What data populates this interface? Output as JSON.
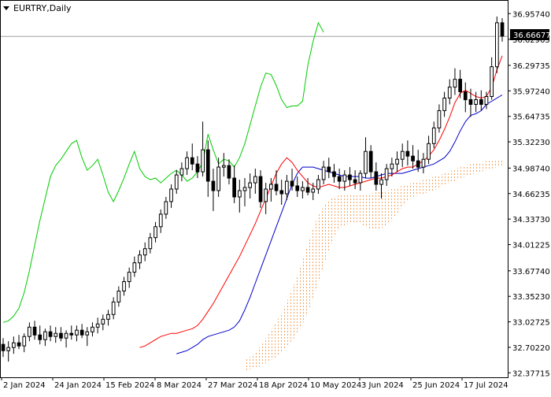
{
  "header": {
    "symbol_timeframe": "EURTRY,Daily"
  },
  "colors": {
    "background": "#ffffff",
    "frame": "#000000",
    "candle": "#000000",
    "tenkan": "#ff0000",
    "kijun": "#0000cc",
    "chikou": "#00cc00",
    "kumo": "#f4a460",
    "price_line": "#a0a0a0",
    "price_label_bg": "#000000",
    "price_label_text": "#ffffff"
  },
  "icons": {
    "menu": "triangle-down-icon"
  },
  "chart_data": {
    "type": "candlestick",
    "title": "EURTRY,Daily",
    "indicator": "Ichimoku Kinko Hyo",
    "current_price": "36.66677",
    "y_axis_labels": [
      "36.95740",
      "36.62965",
      "36.29735",
      "35.97240",
      "35.64735",
      "35.32230",
      "34.98740",
      "34.66235",
      "34.33730",
      "34.01225",
      "33.67740",
      "33.35230",
      "33.02725",
      "32.70220",
      "32.37715"
    ],
    "ylim": [
      32.35,
      36.98
    ],
    "x_axis_labels": [
      "2 Jan 2024",
      "24 Jan 2024",
      "15 Feb 2024",
      "8 Mar 2024",
      "27 Mar 2024",
      "18 Apr 2024",
      "10 May 2024",
      "3 Jun 2024",
      "25 Jun 2024",
      "17 Jul 2024"
    ],
    "grid": false,
    "ohlc": [
      [
        32.74,
        32.82,
        32.58,
        32.66
      ],
      [
        32.66,
        32.78,
        32.52,
        32.7
      ],
      [
        32.7,
        32.84,
        32.62,
        32.76
      ],
      [
        32.76,
        32.86,
        32.68,
        32.72
      ],
      [
        32.72,
        32.88,
        32.64,
        32.84
      ],
      [
        32.84,
        33.02,
        32.78,
        32.96
      ],
      [
        32.96,
        33.04,
        32.8,
        32.86
      ],
      [
        32.86,
        32.98,
        32.74,
        32.8
      ],
      [
        32.8,
        32.94,
        32.72,
        32.9
      ],
      [
        32.9,
        32.98,
        32.78,
        32.84
      ],
      [
        32.84,
        32.96,
        32.76,
        32.88
      ],
      [
        32.88,
        32.96,
        32.78,
        32.82
      ],
      [
        32.82,
        32.92,
        32.7,
        32.88
      ],
      [
        32.88,
        32.98,
        32.8,
        32.86
      ],
      [
        32.86,
        32.98,
        32.78,
        32.92
      ],
      [
        32.92,
        33.0,
        32.82,
        32.86
      ],
      [
        32.86,
        32.96,
        32.72,
        32.9
      ],
      [
        32.9,
        33.02,
        32.84,
        32.96
      ],
      [
        32.96,
        33.08,
        32.88,
        33.0
      ],
      [
        33.0,
        33.12,
        32.92,
        33.06
      ],
      [
        33.06,
        33.18,
        32.98,
        33.12
      ],
      [
        33.12,
        33.34,
        33.06,
        33.28
      ],
      [
        33.28,
        33.48,
        33.22,
        33.42
      ],
      [
        33.42,
        33.6,
        33.36,
        33.54
      ],
      [
        33.54,
        33.72,
        33.46,
        33.66
      ],
      [
        33.66,
        33.86,
        33.6,
        33.78
      ],
      [
        33.78,
        33.94,
        33.7,
        33.88
      ],
      [
        33.88,
        34.04,
        33.8,
        33.96
      ],
      [
        33.96,
        34.16,
        33.9,
        34.1
      ],
      [
        34.1,
        34.3,
        34.04,
        34.24
      ],
      [
        34.24,
        34.46,
        34.16,
        34.4
      ],
      [
        34.4,
        34.62,
        34.34,
        34.56
      ],
      [
        34.56,
        34.78,
        34.48,
        34.72
      ],
      [
        34.72,
        34.96,
        34.66,
        34.9
      ],
      [
        34.9,
        35.06,
        34.82,
        34.98
      ],
      [
        34.98,
        35.2,
        34.9,
        35.12
      ],
      [
        35.12,
        35.3,
        34.96,
        35.04
      ],
      [
        35.04,
        35.14,
        34.86,
        34.94
      ],
      [
        34.94,
        35.58,
        34.88,
        35.22
      ],
      [
        35.22,
        35.34,
        34.62,
        34.82
      ],
      [
        34.82,
        34.98,
        34.44,
        34.7
      ],
      [
        34.7,
        35.12,
        34.62,
        35.0
      ],
      [
        35.0,
        35.18,
        34.88,
        35.02
      ],
      [
        35.02,
        35.1,
        34.78,
        34.86
      ],
      [
        34.86,
        35.02,
        34.54,
        34.62
      ],
      [
        34.62,
        34.84,
        34.42,
        34.7
      ],
      [
        34.7,
        34.86,
        34.5,
        34.74
      ],
      [
        34.74,
        34.92,
        34.6,
        34.8
      ],
      [
        34.8,
        34.98,
        34.66,
        34.88
      ],
      [
        34.88,
        34.96,
        34.48,
        34.56
      ],
      [
        34.56,
        34.8,
        34.4,
        34.72
      ],
      [
        34.72,
        34.86,
        34.56,
        34.78
      ],
      [
        34.78,
        34.96,
        34.64,
        34.7
      ],
      [
        34.7,
        34.84,
        34.52,
        34.66
      ],
      [
        34.66,
        34.9,
        34.58,
        34.82
      ],
      [
        34.82,
        34.98,
        34.7,
        34.76
      ],
      [
        34.76,
        34.88,
        34.62,
        34.7
      ],
      [
        34.7,
        34.82,
        34.6,
        34.74
      ],
      [
        34.74,
        34.86,
        34.64,
        34.68
      ],
      [
        34.68,
        34.8,
        34.58,
        34.72
      ],
      [
        34.72,
        34.9,
        34.66,
        34.84
      ],
      [
        34.84,
        35.08,
        34.78,
        35.0
      ],
      [
        35.0,
        35.12,
        34.86,
        34.94
      ],
      [
        34.94,
        35.04,
        34.8,
        34.88
      ],
      [
        34.88,
        34.98,
        34.72,
        34.82
      ],
      [
        34.82,
        34.96,
        34.7,
        34.9
      ],
      [
        34.9,
        35.0,
        34.76,
        34.84
      ],
      [
        34.84,
        34.96,
        34.72,
        34.8
      ],
      [
        34.8,
        34.96,
        34.7,
        34.92
      ],
      [
        34.92,
        35.38,
        34.86,
        35.2
      ],
      [
        35.2,
        35.28,
        34.86,
        34.94
      ],
      [
        34.94,
        35.06,
        34.7,
        34.78
      ],
      [
        34.78,
        34.92,
        34.6,
        34.84
      ],
      [
        34.84,
        35.04,
        34.76,
        34.98
      ],
      [
        34.98,
        35.12,
        34.88,
        35.04
      ],
      [
        35.04,
        35.2,
        34.94,
        35.1
      ],
      [
        35.1,
        35.3,
        35.0,
        35.2
      ],
      [
        35.2,
        35.34,
        35.02,
        35.14
      ],
      [
        35.14,
        35.28,
        34.98,
        35.08
      ],
      [
        35.08,
        35.22,
        34.94,
        35.0
      ],
      [
        35.0,
        35.18,
        34.92,
        35.1
      ],
      [
        35.1,
        35.4,
        35.04,
        35.3
      ],
      [
        35.3,
        35.58,
        35.24,
        35.5
      ],
      [
        35.5,
        35.8,
        35.44,
        35.72
      ],
      [
        35.72,
        35.96,
        35.64,
        35.88
      ],
      [
        35.88,
        36.12,
        35.8,
        36.02
      ],
      [
        36.02,
        36.26,
        35.92,
        36.12
      ],
      [
        36.12,
        36.24,
        35.88,
        35.96
      ],
      [
        35.96,
        36.08,
        35.7,
        35.86
      ],
      [
        35.86,
        36.0,
        35.64,
        35.8
      ],
      [
        35.8,
        35.96,
        35.7,
        35.86
      ],
      [
        35.86,
        35.98,
        35.72,
        35.8
      ],
      [
        35.8,
        35.96,
        35.74,
        35.9
      ],
      [
        35.9,
        36.4,
        35.86,
        36.28
      ],
      [
        36.28,
        36.92,
        36.2,
        36.84
      ],
      [
        36.84,
        36.9,
        36.6,
        36.67
      ]
    ],
    "tenkan_sen": [
      32.7,
      32.72,
      32.76,
      32.8,
      32.84,
      32.86,
      32.88,
      32.88,
      32.9,
      32.92,
      32.94,
      32.98,
      33.06,
      33.16,
      33.26,
      33.38,
      33.5,
      33.62,
      33.74,
      33.86,
      34.0,
      34.14,
      34.28,
      34.44,
      34.6,
      34.76,
      34.92,
      35.04,
      35.12,
      35.06,
      34.96,
      34.88,
      34.8,
      34.76,
      34.74,
      34.76,
      34.78,
      34.76,
      34.74,
      34.74,
      34.76,
      34.78,
      34.8,
      34.82,
      34.84,
      34.86,
      34.86,
      34.88,
      34.9,
      34.94,
      34.98,
      35.0,
      35.0,
      35.04,
      35.08,
      35.14,
      35.22,
      35.34,
      35.48,
      35.64,
      35.82,
      35.94,
      35.98,
      35.94,
      35.9,
      35.88,
      35.9,
      36.02,
      36.24,
      36.42
    ],
    "kijun_sen": [
      32.62,
      32.64,
      32.66,
      32.7,
      32.74,
      32.8,
      32.84,
      32.86,
      32.88,
      32.9,
      32.92,
      32.96,
      33.04,
      33.18,
      33.34,
      33.52,
      33.7,
      33.88,
      34.06,
      34.24,
      34.42,
      34.6,
      34.78,
      34.92,
      35.0,
      35.0,
      35.0,
      34.98,
      34.96,
      34.94,
      34.92,
      34.9,
      34.88,
      34.88,
      34.88,
      34.88,
      34.86,
      34.86,
      34.88,
      34.9,
      34.92,
      34.92,
      34.92,
      34.92,
      34.94,
      34.96,
      34.98,
      35.0,
      35.02,
      35.04,
      35.08,
      35.12,
      35.2,
      35.32,
      35.46,
      35.58,
      35.66,
      35.68,
      35.72,
      35.8,
      35.84,
      35.88,
      35.92
    ],
    "chikou_span": [
      33.02,
      33.04,
      33.1,
      33.2,
      33.4,
      33.68,
      34.0,
      34.32,
      34.6,
      34.88,
      35.02,
      35.1,
      35.2,
      35.3,
      35.34,
      35.12,
      34.96,
      35.02,
      35.1,
      34.9,
      34.68,
      34.56,
      34.7,
      34.86,
      35.04,
      35.2,
      34.98,
      34.88,
      34.84,
      34.86,
      34.8,
      34.86,
      34.92,
      34.96,
      34.9,
      34.82,
      34.86,
      34.94,
      35.06,
      35.42,
      35.22,
      35.04,
      35.1,
      35.08,
      35.0,
      35.12,
      35.3,
      35.54,
      35.78,
      36.02,
      36.2,
      36.18,
      36.04,
      35.86,
      35.76,
      35.78,
      35.78,
      35.84,
      36.3,
      36.6,
      36.84,
      36.72
    ],
    "kumo_upper": [
      32.56,
      32.58,
      32.64,
      32.72,
      32.82,
      32.92,
      33.02,
      33.14,
      33.28,
      33.44,
      33.62,
      33.82,
      34.02,
      34.22,
      34.38,
      34.5,
      34.58,
      34.62,
      34.64,
      34.66,
      34.66,
      34.66,
      34.66,
      34.66,
      34.66,
      34.68,
      34.7,
      34.7,
      34.72,
      34.74,
      34.76,
      34.78,
      34.8,
      34.82,
      34.84,
      34.86,
      34.88,
      34.9,
      34.92,
      34.94,
      34.98,
      35.0,
      35.02,
      35.04,
      35.06,
      35.06,
      35.08,
      35.08,
      35.08,
      35.1
    ],
    "kumo_lower": [
      32.4,
      32.42,
      32.44,
      32.46,
      32.5,
      32.54,
      32.58,
      32.64,
      32.7,
      32.78,
      32.88,
      33.0,
      33.14,
      33.32,
      33.52,
      33.74,
      33.94,
      34.1,
      34.22,
      34.26,
      34.28,
      34.3,
      34.28,
      34.24,
      34.2,
      34.2,
      34.22,
      34.26,
      34.32,
      34.4,
      34.5,
      34.58,
      34.62,
      34.64,
      34.66,
      34.68,
      34.7,
      34.74,
      34.78,
      34.8,
      34.82,
      34.86,
      34.88,
      34.9,
      34.92,
      34.94,
      34.96,
      34.98,
      35.0,
      35.02
    ]
  }
}
